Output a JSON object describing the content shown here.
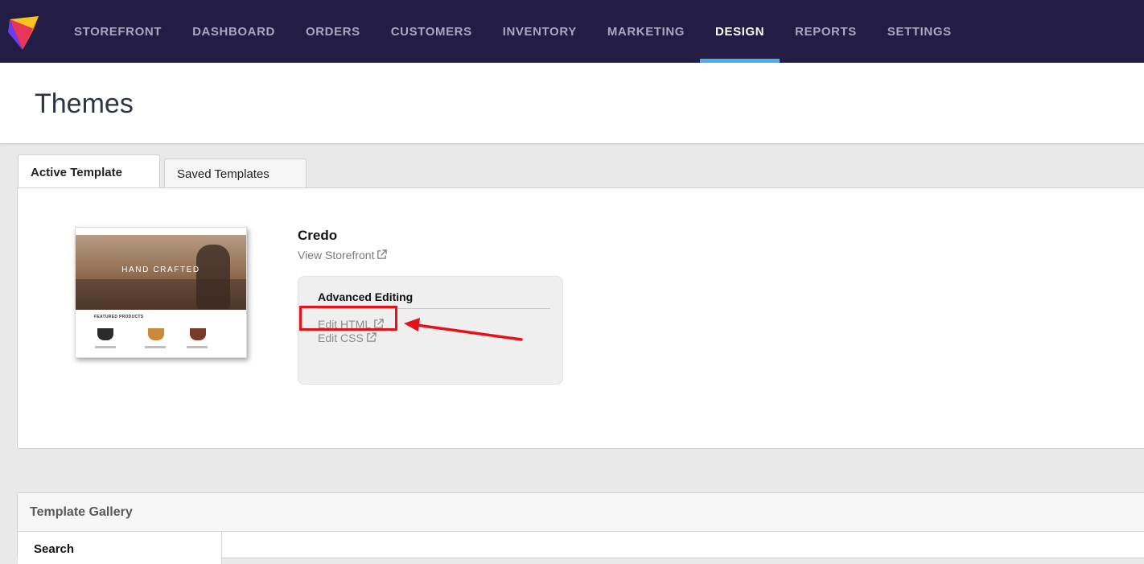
{
  "nav": {
    "items": [
      {
        "label": "STOREFRONT"
      },
      {
        "label": "DASHBOARD"
      },
      {
        "label": "ORDERS"
      },
      {
        "label": "CUSTOMERS"
      },
      {
        "label": "INVENTORY"
      },
      {
        "label": "MARKETING"
      },
      {
        "label": "DESIGN",
        "active": true
      },
      {
        "label": "REPORTS"
      },
      {
        "label": "SETTINGS"
      }
    ],
    "active_indicator_color": "#4aaee8",
    "bar_color": "#231d45"
  },
  "page": {
    "title": "Themes"
  },
  "tabs": [
    {
      "label": "Active Template",
      "active": true
    },
    {
      "label": "Saved Templates",
      "active": false
    }
  ],
  "active_template": {
    "name": "Credo",
    "view_link": "View Storefront",
    "thumbnail": {
      "hero_text": "HAND CRAFTED",
      "section_title": "FEATURED PRODUCTS"
    },
    "advanced_editing": {
      "title": "Advanced Editing",
      "edit_html": "Edit HTML",
      "edit_css": "Edit CSS"
    }
  },
  "annotation": {
    "color": "#e8101a"
  },
  "gallery": {
    "title": "Template Gallery",
    "side_label": "Search"
  },
  "icons": {
    "logo": "logo-icon",
    "external": "external-link-icon"
  }
}
